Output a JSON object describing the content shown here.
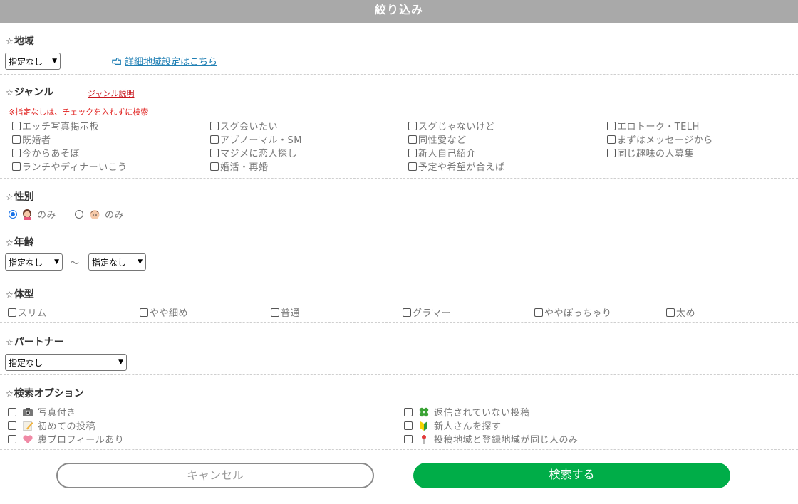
{
  "header": {
    "title": "絞り込み"
  },
  "region": {
    "title": "地域",
    "select_value": "指定なし",
    "detail_link": "詳細地域設定はこちら"
  },
  "genre": {
    "title": "ジャンル",
    "help_link": "ジャンル説明",
    "note": "※指定なしは、チェックを入れずに検索",
    "items": [
      "エッチ写真掲示板",
      "スグ会いたい",
      "スグじゃないけど",
      "エロトーク・TELH",
      "既婚者",
      "アブノーマル・SM",
      "同性愛など",
      "まずはメッセージから",
      "今からあそぼ",
      "マジメに恋人探し",
      "新人自己紹介",
      "同じ趣味の人募集",
      "ランチやディナーいこう",
      "婚活・再婚",
      "予定や希望が合えば"
    ]
  },
  "gender": {
    "title": "性別",
    "options": [
      {
        "label": "のみ",
        "icon": "woman-icon",
        "selected": true
      },
      {
        "label": "のみ",
        "icon": "man-icon",
        "selected": false
      }
    ]
  },
  "age": {
    "title": "年齢",
    "from_value": "指定なし",
    "separator": "～",
    "to_value": "指定なし"
  },
  "body_type": {
    "title": "体型",
    "items": [
      "スリム",
      "やや細め",
      "普通",
      "グラマー",
      "ややぽっちゃり",
      "太め"
    ]
  },
  "partner": {
    "title": "パートナー",
    "select_value": "指定なし"
  },
  "options": {
    "title": "検索オプション",
    "items": [
      {
        "label": "写真付き",
        "icon": "camera-icon"
      },
      {
        "label": "返信されていない投稿",
        "icon": "clover-icon"
      },
      {
        "label": "初めての投稿",
        "icon": "memo-icon"
      },
      {
        "label": "新人さんを探す",
        "icon": "beginner-mark-icon"
      },
      {
        "label": "裏プロフィールあり",
        "icon": "heart-icon"
      },
      {
        "label": "投稿地域と登録地域が同じ人のみ",
        "icon": "pushpin-icon"
      }
    ]
  },
  "buttons": {
    "cancel": "キャンセル",
    "search": "検索する"
  },
  "colors": {
    "header_bg": "#a9a9a9",
    "search_button": "#00ad48",
    "link": "#1f7fb4",
    "note": "#e0201e"
  }
}
